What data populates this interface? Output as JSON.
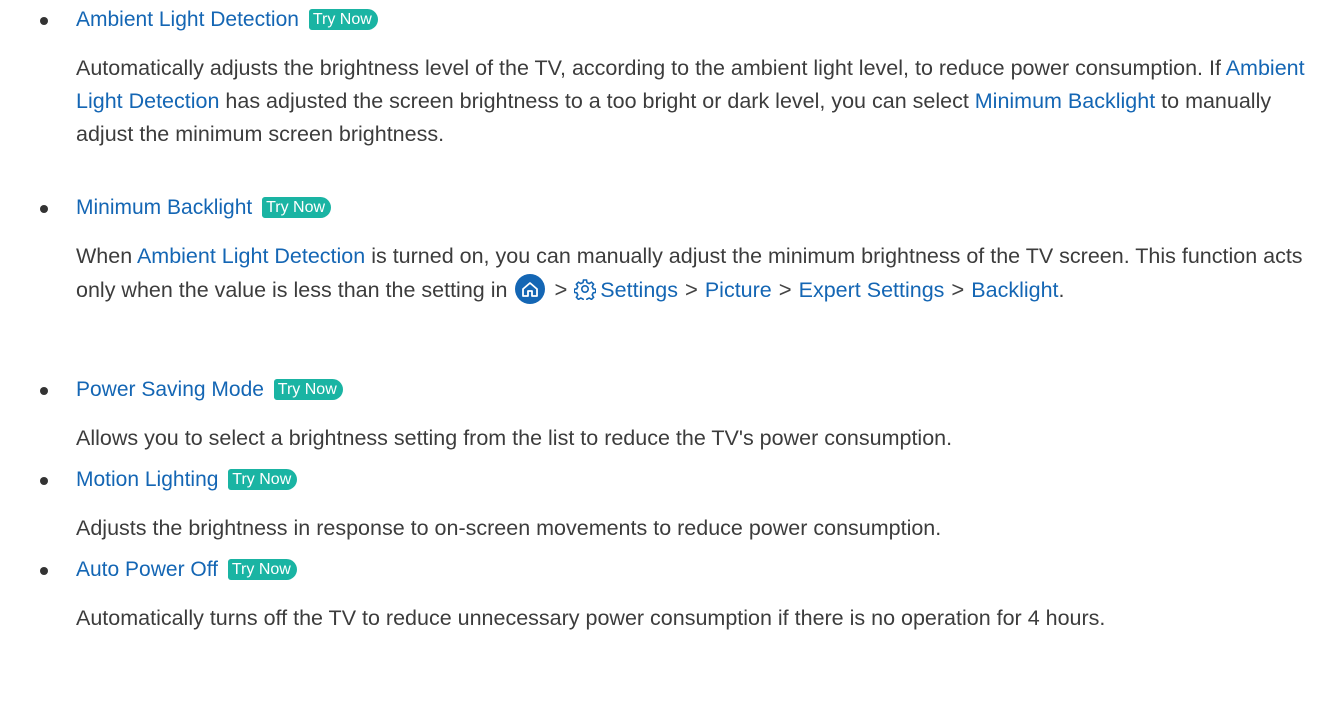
{
  "try_now_label": "Try Now",
  "items": [
    {
      "heading": "Ambient Light Detection",
      "body": {
        "p1": "Automatically adjusts the brightness level of the TV, according to the ambient light level, to reduce power consumption. If ",
        "link1": "Ambient Light Detection",
        "p2": " has adjusted the screen brightness to a too bright or dark level, you can select ",
        "link2": "Minimum Backlight",
        "p3": " to manually adjust the minimum screen brightness."
      }
    },
    {
      "heading": "Minimum Backlight",
      "body": {
        "p0": "When ",
        "link1": "Ambient Light Detection",
        "p1": " is turned on, you can manually adjust the minimum brightness of the TV screen. This function acts only when the value is less than the setting in ",
        "path_home_icon": "home-icon",
        "path_settings_icon": "gear-icon",
        "path_settings": "Settings",
        "path_picture": "Picture",
        "path_expert": "Expert Settings",
        "path_backlight": "Backlight",
        "separator": ">",
        "end": "."
      }
    },
    {
      "heading": "Power Saving Mode",
      "body": "Allows you to select a brightness setting from the list to reduce the TV's power consumption."
    },
    {
      "heading": "Motion Lighting",
      "body": "Adjusts the brightness in response to on-screen movements to reduce power consumption."
    },
    {
      "heading": "Auto Power Off",
      "body": "Automatically turns off the TV to reduce unnecessary power consumption if there is no operation for 4 hours."
    }
  ],
  "colors": {
    "link": "#1466b4",
    "try_now_bg": "#1ab4a3",
    "text": "#3c3c3c"
  }
}
